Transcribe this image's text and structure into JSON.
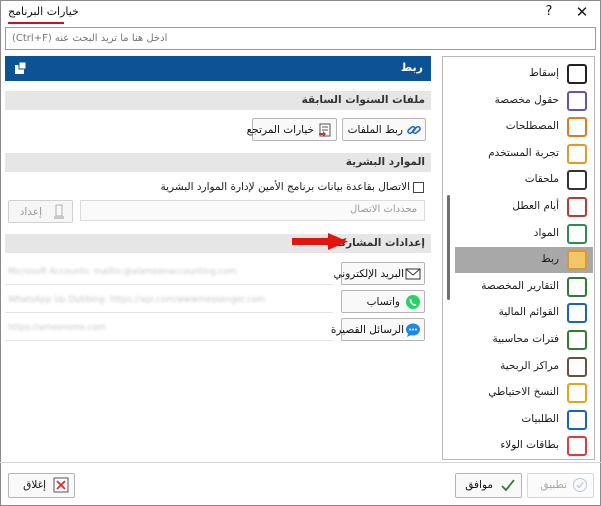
{
  "window": {
    "title": "خيارات البرنامج",
    "help_glyph": "?",
    "close_glyph": "✕"
  },
  "search": {
    "placeholder": "أدخل هنا ما تريد البحث عنه (Ctrl+F)"
  },
  "nav": {
    "items": [
      {
        "label": "إسقاط",
        "icon": "barcode-icon",
        "color": "#222222"
      },
      {
        "label": "حقول مخصصة",
        "icon": "custom-fields-icon",
        "color": "#6a4fb6"
      },
      {
        "label": "المصطلحات",
        "icon": "terms-icon",
        "color": "#e07b1a"
      },
      {
        "label": "تجربة المستخدم",
        "icon": "user-experience-icon",
        "color": "#e29a1f"
      },
      {
        "label": "ملحقات",
        "icon": "plugins-icon",
        "color": "#333333"
      },
      {
        "label": "أيام العطل",
        "icon": "calendar-icon",
        "color": "#c0392b"
      },
      {
        "label": "المواد",
        "icon": "materials-icon",
        "color": "#2e8b57"
      },
      {
        "label": "ربط",
        "icon": "link-icon",
        "color": "#d89a2b",
        "selected": true
      },
      {
        "label": "التقارير المخصصة",
        "icon": "custom-reports-icon",
        "color": "#2e7d32"
      },
      {
        "label": "القوائم المالية",
        "icon": "financial-statements-icon",
        "color": "#1565c0"
      },
      {
        "label": "فترات محاسبية",
        "icon": "accounting-periods-icon",
        "color": "#2e7d32"
      },
      {
        "label": "مراكز الربحية",
        "icon": "profit-centers-icon",
        "color": "#6d4c41"
      },
      {
        "label": "النسخ الاحتياطي",
        "icon": "backup-icon",
        "color": "#e8a317"
      },
      {
        "label": "الطلبيات",
        "icon": "orders-icon",
        "color": "#1565c0"
      },
      {
        "label": "بطاقات الولاء",
        "icon": "loyalty-card-icon",
        "color": "#e53935"
      }
    ]
  },
  "main": {
    "header": "ربط",
    "previous_years": {
      "title": "ملفات السنوات السابقة",
      "link_files_label": "ربط الملفات",
      "restore_options_label": "خيارات المرتجع"
    },
    "hr": {
      "title": "الموارد البشرية",
      "checkbox_label": "الاتصال بقاعدة بيانات برنامج الأمين لإدارة الموارد البشرية",
      "connection_label": "محددات الاتصال",
      "setup_label": "إعداد"
    },
    "sharing": {
      "title": "إعدادات المشاركة",
      "rows": [
        {
          "button": "البريد الإلكتروني",
          "icon": "email-icon",
          "value": "Microsoft Accounts: mailto:@alameenaccounting.com"
        },
        {
          "button": "واتساب",
          "icon": "whatsapp-icon",
          "value": "WhatsApp Up Dubbing: https://api.com/wwwmessenger.com"
        },
        {
          "button": "الرسائل القصيرة",
          "icon": "sms-icon",
          "value": "https://ameensms.com"
        }
      ]
    }
  },
  "footer": {
    "close_label": "إغلاق",
    "ok_label": "موافق",
    "apply_label": "تطبيق"
  }
}
